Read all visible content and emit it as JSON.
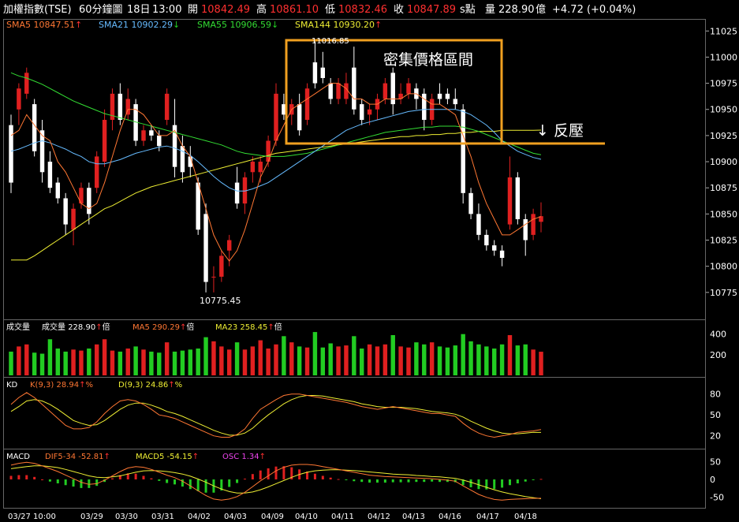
{
  "header": {
    "title": "加權指數(TSE)",
    "period": "60分鐘圖",
    "date": "18日",
    "time": "13:00",
    "open_label": "開",
    "open": "10842.49",
    "high_label": "高",
    "high": "10861.10",
    "low_label": "低",
    "low": "10832.46",
    "close_label": "收",
    "close": "10847.89",
    "unit_s": "s點",
    "vol_label": "量",
    "vol": "228.90",
    "vol_unit": "億",
    "change": "+4.72 (+0.04%)"
  },
  "ma_legend": [
    {
      "label": "SMA5",
      "value": "10847.51",
      "arrow": "↑",
      "color": "#ff7733"
    },
    {
      "label": "SMA21",
      "value": "10902.29",
      "arrow": "↓",
      "color": "#66bbff"
    },
    {
      "label": "SMA55",
      "value": "10906.59",
      "arrow": "↓",
      "color": "#33dd33"
    },
    {
      "label": "SMA144",
      "value": "10930.20",
      "arrow": "↑",
      "color": "#eeee33"
    }
  ],
  "vol_legend": {
    "name": "成交量",
    "label": "成交量",
    "value": "228.90",
    "arrow": "↑",
    "unit": "倍",
    "ma5_label": "MA5",
    "ma5": "290.29",
    "ma5_arrow": "↑",
    "ma5_unit": "倍",
    "ma23_label": "MA23",
    "ma23": "258.45",
    "ma23_arrow": "↑",
    "ma23_unit": "倍"
  },
  "kd_legend": {
    "name": "KD",
    "k_label": "K(9,3)",
    "k": "28.94",
    "k_arrow": "↑",
    "k_unit": "%",
    "d_label": "D(9,3)",
    "d": "24.86",
    "d_arrow": "↑",
    "d_unit": "%"
  },
  "macd_legend": {
    "name": "MACD",
    "dif_label": "DIF5-34",
    "dif": "-52.81",
    "dif_arrow": "↑",
    "macd_label": "MACD5",
    "macd": "-54.15",
    "macd_arrow": "↑",
    "osc_label": "OSC",
    "osc": "1.34",
    "osc_arrow": "↑"
  },
  "annotations": {
    "box_label": "密集價格區間",
    "resist_label": "↓ 反壓",
    "high_mark": "11016.85",
    "low_mark": "10775.45"
  },
  "colors": {
    "up": "#e02020",
    "down": "#ffffff",
    "vol_up": "#e02020",
    "vol_down": "#22cc22",
    "sma5": "#ff7733",
    "sma21": "#66bbff",
    "sma55": "#33dd33",
    "sma144": "#eeee33",
    "box": "#f0a020"
  },
  "chart_data": {
    "type": "candlestick",
    "x_ticks": [
      "03/27 10:00",
      "03/29",
      "03/30",
      "03/31",
      "04/02",
      "04/03",
      "04/09",
      "04/10",
      "04/11",
      "04/12",
      "04/13",
      "04/16",
      "04/17",
      "04/18"
    ],
    "price_axis": {
      "ticks": [
        10775,
        10800,
        10825,
        10850,
        10875,
        10900,
        10925,
        10950,
        10975,
        11000,
        11025
      ],
      "ylim": [
        10753,
        11032
      ]
    },
    "volume_axis": {
      "ticks": [
        200,
        400
      ],
      "ylim": [
        0,
        520
      ]
    },
    "kd_axis": {
      "ticks": [
        20,
        50,
        80
      ],
      "ylim": [
        5,
        100
      ]
    },
    "macd_axis": {
      "ticks": [
        50,
        0,
        -50
      ],
      "ylim": [
        -75,
        75
      ]
    },
    "candles": [
      {
        "o": 10935,
        "h": 10945,
        "l": 10870,
        "c": 10880
      },
      {
        "o": 10950,
        "h": 10975,
        "l": 10935,
        "c": 10970
      },
      {
        "o": 10965,
        "h": 10990,
        "l": 10960,
        "c": 10985
      },
      {
        "o": 10955,
        "h": 10960,
        "l": 10905,
        "c": 10910
      },
      {
        "o": 10930,
        "h": 10940,
        "l": 10880,
        "c": 10890
      },
      {
        "o": 10900,
        "h": 10910,
        "l": 10870,
        "c": 10875
      },
      {
        "o": 10880,
        "h": 10885,
        "l": 10860,
        "c": 10865
      },
      {
        "o": 10865,
        "h": 10870,
        "l": 10830,
        "c": 10840
      },
      {
        "o": 10835,
        "h": 10860,
        "l": 10820,
        "c": 10855
      },
      {
        "o": 10860,
        "h": 10880,
        "l": 10855,
        "c": 10875
      },
      {
        "o": 10875,
        "h": 10880,
        "l": 10840,
        "c": 10850
      },
      {
        "o": 10875,
        "h": 10910,
        "l": 10870,
        "c": 10905
      },
      {
        "o": 10900,
        "h": 10950,
        "l": 10895,
        "c": 10940
      },
      {
        "o": 10940,
        "h": 10970,
        "l": 10930,
        "c": 10965
      },
      {
        "o": 10965,
        "h": 10975,
        "l": 10935,
        "c": 10940
      },
      {
        "o": 10945,
        "h": 10970,
        "l": 10940,
        "c": 10960
      },
      {
        "o": 10955,
        "h": 10960,
        "l": 10915,
        "c": 10920
      },
      {
        "o": 10920,
        "h": 10935,
        "l": 10915,
        "c": 10930
      },
      {
        "o": 10930,
        "h": 10935,
        "l": 10920,
        "c": 10925
      },
      {
        "o": 10925,
        "h": 10930,
        "l": 10910,
        "c": 10915
      },
      {
        "o": 10940,
        "h": 10970,
        "l": 10935,
        "c": 10965
      },
      {
        "o": 10935,
        "h": 10960,
        "l": 10885,
        "c": 10895
      },
      {
        "o": 10915,
        "h": 10925,
        "l": 10880,
        "c": 10890
      },
      {
        "o": 10905,
        "h": 10915,
        "l": 10885,
        "c": 10895
      },
      {
        "o": 10880,
        "h": 10885,
        "l": 10830,
        "c": 10835
      },
      {
        "o": 10850,
        "h": 10860,
        "l": 10775,
        "c": 10785
      },
      {
        "o": 10790,
        "h": 10800,
        "l": 10775,
        "c": 10790
      },
      {
        "o": 10790,
        "h": 10815,
        "l": 10785,
        "c": 10810
      },
      {
        "o": 10815,
        "h": 10830,
        "l": 10800,
        "c": 10825
      },
      {
        "o": 10880,
        "h": 10895,
        "l": 10855,
        "c": 10860
      },
      {
        "o": 10860,
        "h": 10890,
        "l": 10850,
        "c": 10885
      },
      {
        "o": 10890,
        "h": 10905,
        "l": 10880,
        "c": 10900
      },
      {
        "o": 10890,
        "h": 10905,
        "l": 10880,
        "c": 10900
      },
      {
        "o": 10900,
        "h": 10925,
        "l": 10895,
        "c": 10920
      },
      {
        "o": 10920,
        "h": 10975,
        "l": 10915,
        "c": 10965
      },
      {
        "o": 10955,
        "h": 10965,
        "l": 10940,
        "c": 10945
      },
      {
        "o": 10945,
        "h": 10960,
        "l": 10935,
        "c": 10955
      },
      {
        "o": 10955,
        "h": 10965,
        "l": 10925,
        "c": 10930
      },
      {
        "o": 10940,
        "h": 10975,
        "l": 10935,
        "c": 10970
      },
      {
        "o": 10995,
        "h": 11017,
        "l": 10970,
        "c": 10975
      },
      {
        "o": 10990,
        "h": 11005,
        "l": 10975,
        "c": 10980
      },
      {
        "o": 10975,
        "h": 10980,
        "l": 10955,
        "c": 10960
      },
      {
        "o": 10960,
        "h": 10980,
        "l": 10955,
        "c": 10975
      },
      {
        "o": 10960,
        "h": 10985,
        "l": 10955,
        "c": 10975
      },
      {
        "o": 10990,
        "h": 11010,
        "l": 10945,
        "c": 10950
      },
      {
        "o": 10955,
        "h": 10960,
        "l": 10935,
        "c": 10940
      },
      {
        "o": 10945,
        "h": 10955,
        "l": 10935,
        "c": 10950
      },
      {
        "o": 10950,
        "h": 10965,
        "l": 10940,
        "c": 10960
      },
      {
        "o": 10960,
        "h": 10980,
        "l": 10955,
        "c": 10975
      },
      {
        "o": 10985,
        "h": 10990,
        "l": 10945,
        "c": 10955
      },
      {
        "o": 10960,
        "h": 10975,
        "l": 10955,
        "c": 10965
      },
      {
        "o": 10965,
        "h": 10980,
        "l": 10960,
        "c": 10975
      },
      {
        "o": 10970,
        "h": 10975,
        "l": 10950,
        "c": 10960
      },
      {
        "o": 10965,
        "h": 10970,
        "l": 10930,
        "c": 10940
      },
      {
        "o": 10940,
        "h": 10965,
        "l": 10935,
        "c": 10960
      },
      {
        "o": 10965,
        "h": 10975,
        "l": 10955,
        "c": 10960
      },
      {
        "o": 10965,
        "h": 10970,
        "l": 10955,
        "c": 10960
      },
      {
        "o": 10960,
        "h": 10970,
        "l": 10950,
        "c": 10955
      },
      {
        "o": 10950,
        "h": 10955,
        "l": 10860,
        "c": 10870
      },
      {
        "o": 10870,
        "h": 10875,
        "l": 10845,
        "c": 10850
      },
      {
        "o": 10850,
        "h": 10860,
        "l": 10825,
        "c": 10830
      },
      {
        "o": 10830,
        "h": 10835,
        "l": 10815,
        "c": 10820
      },
      {
        "o": 10820,
        "h": 10825,
        "l": 10810,
        "c": 10815
      },
      {
        "o": 10815,
        "h": 10820,
        "l": 10800,
        "c": 10808
      },
      {
        "o": 10840,
        "h": 10905,
        "l": 10835,
        "c": 10885
      },
      {
        "o": 10885,
        "h": 10890,
        "l": 10840,
        "c": 10845
      },
      {
        "o": 10845,
        "h": 10850,
        "l": 10810,
        "c": 10825
      },
      {
        "o": 10830,
        "h": 10855,
        "l": 10825,
        "c": 10850
      },
      {
        "o": 10842.49,
        "h": 10861.1,
        "l": 10832.46,
        "c": 10847.89
      }
    ],
    "volume": [
      230,
      280,
      300,
      220,
      210,
      350,
      260,
      230,
      250,
      240,
      260,
      300,
      350,
      240,
      230,
      260,
      280,
      250,
      230,
      220,
      320,
      230,
      240,
      250,
      260,
      370,
      330,
      280,
      250,
      320,
      250,
      280,
      340,
      260,
      300,
      380,
      320,
      280,
      270,
      420,
      270,
      310,
      280,
      290,
      380,
      260,
      300,
      280,
      300,
      390,
      280,
      270,
      320,
      300,
      320,
      280,
      270,
      290,
      400,
      330,
      300,
      280,
      260,
      300,
      390,
      290,
      300,
      250,
      229
    ],
    "sma5": [
      10925,
      10930,
      10945,
      10935,
      10925,
      10920,
      10900,
      10890,
      10875,
      10860,
      10855,
      10860,
      10880,
      10905,
      10930,
      10950,
      10950,
      10945,
      10935,
      10925,
      10925,
      10930,
      10915,
      10905,
      10880,
      10855,
      10830,
      10815,
      10805,
      10815,
      10835,
      10860,
      10885,
      10900,
      10920,
      10935,
      10950,
      10955,
      10960,
      10965,
      10970,
      10975,
      10975,
      10970,
      10960,
      10960,
      10955,
      10955,
      10960,
      10960,
      10960,
      10965,
      10965,
      10960,
      10955,
      10955,
      10950,
      10945,
      10925,
      10905,
      10880,
      10860,
      10845,
      10830,
      10830,
      10835,
      10840,
      10845,
      10847.51
    ],
    "sma21": [
      10910,
      10912,
      10915,
      10918,
      10920,
      10918,
      10915,
      10912,
      10908,
      10905,
      10900,
      10898,
      10898,
      10900,
      10902,
      10905,
      10908,
      10910,
      10912,
      10914,
      10915,
      10913,
      10910,
      10906,
      10900,
      10893,
      10886,
      10880,
      10875,
      10872,
      10872,
      10874,
      10877,
      10880,
      10885,
      10890,
      10895,
      10900,
      10905,
      10910,
      10915,
      10920,
      10925,
      10930,
      10933,
      10936,
      10938,
      10940,
      10942,
      10944,
      10946,
      10948,
      10949,
      10950,
      10950,
      10950,
      10950,
      10950,
      10948,
      10945,
      10940,
      10935,
      10928,
      10920,
      10915,
      10910,
      10907,
      10904,
      10902.29
    ],
    "sma55": [
      10985,
      10982,
      10980,
      10977,
      10974,
      10970,
      10966,
      10962,
      10958,
      10955,
      10952,
      10949,
      10946,
      10944,
      10942,
      10940,
      10938,
      10936,
      10934,
      10932,
      10930,
      10928,
      10926,
      10924,
      10922,
      10920,
      10918,
      10916,
      10913,
      10910,
      10908,
      10907,
      10906,
      10905,
      10905,
      10905,
      10906,
      10907,
      10908,
      10910,
      10912,
      10914,
      10916,
      10918,
      10920,
      10922,
      10924,
      10926,
      10928,
      10929,
      10930,
      10931,
      10932,
      10933,
      10933,
      10934,
      10934,
      10934,
      10933,
      10931,
      10929,
      10926,
      10923,
      10920,
      10917,
      10914,
      10911,
      10908,
      10906.59
    ],
    "sma144": [
      10806,
      10806,
      10806,
      10810,
      10815,
      10820,
      10825,
      10830,
      10835,
      10840,
      10845,
      10850,
      10855,
      10858,
      10862,
      10866,
      10870,
      10873,
      10876,
      10878,
      10880,
      10882,
      10884,
      10886,
      10888,
      10890,
      10892,
      10894,
      10896,
      10898,
      10900,
      10902,
      10904,
      10906,
      10908,
      10909,
      10910,
      10911,
      10912,
      10913,
      10914,
      10915,
      10916,
      10917,
      10918,
      10919,
      10920,
      10921,
      10922,
      10923,
      10924,
      10924,
      10925,
      10925,
      10926,
      10926,
      10927,
      10927,
      10928,
      10928,
      10929,
      10929,
      10929,
      10930,
      10930,
      10930,
      10930,
      10930,
      10930.2
    ],
    "k": [
      65,
      75,
      82,
      75,
      65,
      55,
      45,
      35,
      30,
      30,
      32,
      40,
      52,
      62,
      70,
      72,
      70,
      65,
      58,
      50,
      48,
      45,
      40,
      35,
      30,
      25,
      20,
      18,
      18,
      22,
      30,
      45,
      58,
      65,
      72,
      78,
      80,
      80,
      78,
      76,
      74,
      72,
      70,
      68,
      65,
      62,
      60,
      58,
      60,
      62,
      60,
      58,
      56,
      54,
      52,
      52,
      50,
      48,
      38,
      30,
      24,
      20,
      18,
      20,
      22,
      25,
      26,
      27,
      28.94
    ],
    "d": [
      55,
      62,
      70,
      72,
      70,
      65,
      58,
      50,
      42,
      38,
      35,
      36,
      42,
      50,
      58,
      64,
      67,
      67,
      64,
      60,
      55,
      52,
      48,
      43,
      38,
      33,
      28,
      24,
      21,
      21,
      24,
      31,
      41,
      50,
      58,
      66,
      72,
      76,
      78,
      78,
      77,
      75,
      73,
      71,
      69,
      66,
      64,
      62,
      61,
      61,
      61,
      60,
      59,
      57,
      55,
      54,
      53,
      51,
      47,
      41,
      36,
      31,
      27,
      24,
      23,
      23,
      24,
      25,
      24.86
    ],
    "dif": [
      40,
      45,
      48,
      45,
      38,
      30,
      22,
      12,
      2,
      -8,
      -14,
      -12,
      -2,
      10,
      22,
      32,
      36,
      34,
      28,
      20,
      12,
      5,
      -5,
      -18,
      -32,
      -45,
      -55,
      -58,
      -55,
      -48,
      -36,
      -20,
      -4,
      10,
      24,
      34,
      40,
      42,
      42,
      40,
      36,
      32,
      28,
      24,
      20,
      16,
      12,
      10,
      8,
      7,
      6,
      5,
      4,
      3,
      2,
      0,
      -2,
      -5,
      -18,
      -30,
      -42,
      -50,
      -56,
      -58,
      -56,
      -55,
      -54,
      -53,
      -52.81
    ],
    "macd": [
      30,
      33,
      36,
      38,
      38,
      36,
      33,
      28,
      22,
      16,
      10,
      6,
      5,
      7,
      10,
      15,
      20,
      24,
      25,
      24,
      22,
      19,
      15,
      9,
      1,
      -8,
      -18,
      -27,
      -34,
      -38,
      -38,
      -35,
      -29,
      -21,
      -12,
      -3,
      6,
      14,
      20,
      24,
      26,
      27,
      27,
      26,
      25,
      23,
      21,
      19,
      17,
      15,
      14,
      13,
      11,
      10,
      8,
      7,
      5,
      3,
      -2,
      -8,
      -15,
      -22,
      -29,
      -35,
      -40,
      -44,
      -48,
      -51,
      -54.15
    ],
    "osc": [
      10,
      12,
      12,
      7,
      0,
      -6,
      -11,
      -16,
      -20,
      -24,
      -24,
      -18,
      -7,
      3,
      12,
      17,
      16,
      10,
      3,
      -4,
      -10,
      -14,
      -20,
      -27,
      -33,
      -37,
      -37,
      -31,
      -21,
      -10,
      2,
      15,
      25,
      31,
      36,
      37,
      34,
      28,
      22,
      16,
      10,
      5,
      1,
      -2,
      -5,
      -7,
      -9,
      -9,
      -9,
      -8,
      -8,
      -8,
      -7,
      -7,
      -6,
      -7,
      -7,
      -8,
      -16,
      -22,
      -27,
      -28,
      -27,
      -23,
      -16,
      -11,
      -6,
      -2,
      1.34
    ]
  }
}
